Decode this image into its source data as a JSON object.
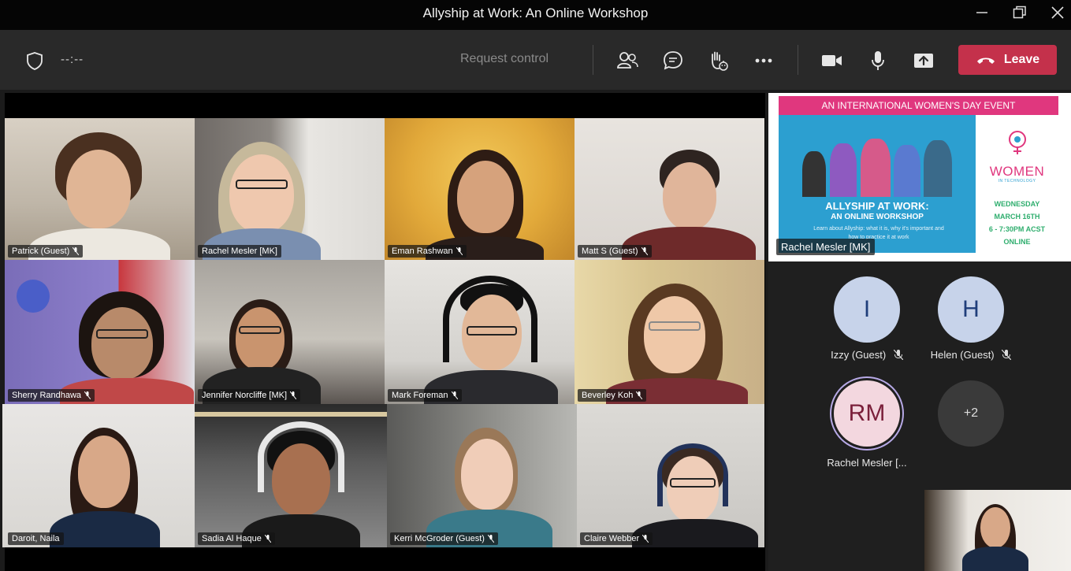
{
  "window": {
    "title": "Allyship at Work: An Online Workshop",
    "controls": [
      "minimize",
      "restore",
      "close"
    ]
  },
  "toolbar": {
    "timer": "--:--",
    "request_control_label": "Request control",
    "leave_label": "Leave",
    "icons": [
      "shield-icon",
      "participants-icon",
      "chat-icon",
      "raise-hand-icon",
      "more-icon",
      "camera-icon",
      "microphone-icon",
      "share-icon",
      "phone-hangup-icon"
    ]
  },
  "participants": [
    {
      "name": "Patrick (Guest)",
      "muted": true
    },
    {
      "name": "Rachel Mesler [MK]",
      "muted": false
    },
    {
      "name": "Eman Rashwan",
      "muted": true
    },
    {
      "name": "Matt S (Guest)",
      "muted": true
    },
    {
      "name": "Sherry Randhawa",
      "muted": true
    },
    {
      "name": "Jennifer Norcliffe [MK]",
      "muted": true
    },
    {
      "name": "Mark Foreman",
      "muted": true
    },
    {
      "name": "Beverley Koh",
      "muted": true
    },
    {
      "name": "Daroit, Naila",
      "muted": false
    },
    {
      "name": "Sadia Al Haque",
      "muted": true
    },
    {
      "name": "Kerri McGroder (Guest)",
      "muted": true
    },
    {
      "name": "Claire Webber",
      "muted": true
    }
  ],
  "shared_content": {
    "presenter": "Rachel Mesler [MK]",
    "banner": "AN INTERNATIONAL WOMEN'S DAY EVENT",
    "heading": "ALLYSHIP AT WORK:",
    "subheading": "AN ONLINE WORKSHOP",
    "blurb": "Learn about Allyship: what it is, why it's important and how to practice it at work",
    "logo_text": "WOMEN",
    "logo_sub": "IN TECHNOLOGY",
    "date_line1": "WEDNESDAY",
    "date_line2": "MARCH 16TH",
    "time": "6 - 7:30PM ACST",
    "location": "ONLINE"
  },
  "audio_participants": [
    {
      "initials": "I",
      "name": "Izzy (Guest)",
      "muted": true
    },
    {
      "initials": "H",
      "name": "Helen (Guest)",
      "muted": true
    },
    {
      "initials": "RM",
      "name": "Rachel Mesler [...",
      "muted": false
    }
  ],
  "overflow": {
    "label": "+2"
  },
  "colors": {
    "leave": "#c4314b",
    "toolbar": "#292929",
    "titlebar": "#050505",
    "banner_pink": "#e0377e",
    "share_blue": "#2c9fd0"
  }
}
